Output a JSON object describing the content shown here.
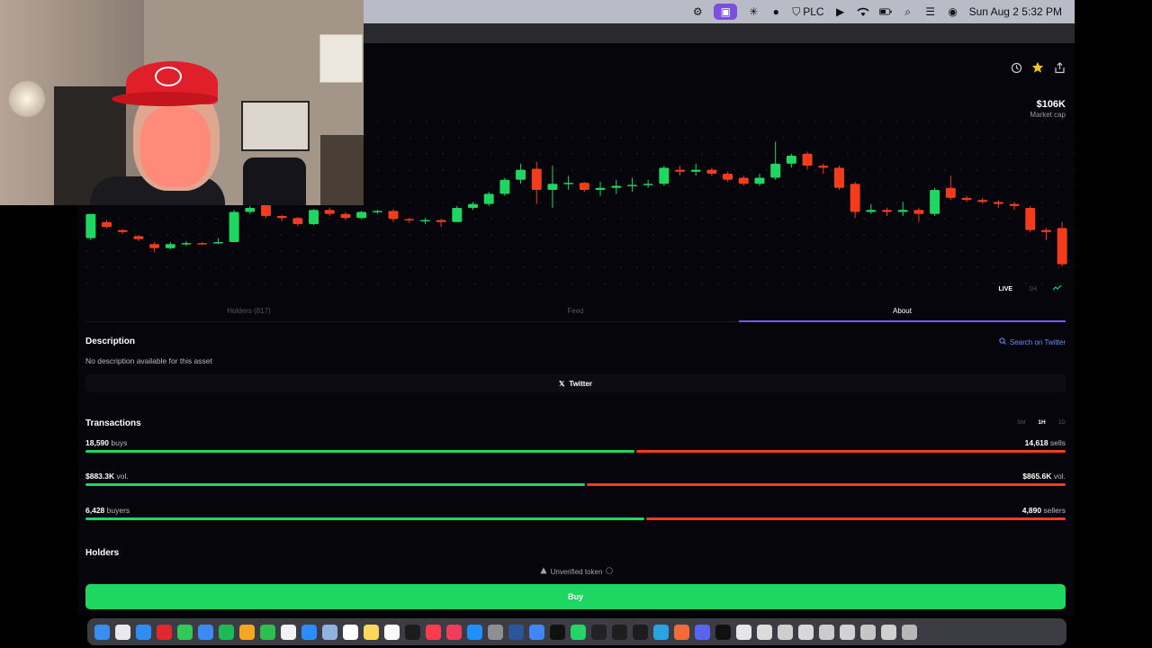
{
  "menubar": {
    "plc_label": "PLC",
    "clock": "Sun Aug 2  5:32 PM",
    "icons": [
      "settings-icon",
      "screen-record-icon",
      "sparkle-icon",
      "camera-icon",
      "shield-icon",
      "play-icon",
      "wifi-icon",
      "battery-icon",
      "search-icon",
      "control-center-icon",
      "siri-icon"
    ]
  },
  "toolbar": {
    "icons": [
      "history-icon",
      "star-icon",
      "share-icon"
    ]
  },
  "market_cap": {
    "value": "$106K",
    "label": "Market cap"
  },
  "chart_data": {
    "type": "candlestick",
    "title": "",
    "up_color": "#1ed760",
    "down_color": "#f23c1c",
    "candles": [
      {
        "dir": "up",
        "open": 46,
        "close": 70,
        "high": 70,
        "low": 44
      },
      {
        "dir": "down",
        "open": 62,
        "close": 57,
        "high": 64,
        "low": 56
      },
      {
        "dir": "down",
        "open": 54,
        "close": 52,
        "high": 55,
        "low": 50
      },
      {
        "dir": "down",
        "open": 48,
        "close": 45,
        "high": 49,
        "low": 43
      },
      {
        "dir": "down",
        "open": 40,
        "close": 36,
        "high": 42,
        "low": 32
      },
      {
        "dir": "up",
        "open": 36,
        "close": 40,
        "high": 42,
        "low": 35
      },
      {
        "dir": "up",
        "open": 40,
        "close": 41,
        "high": 43,
        "low": 38
      },
      {
        "dir": "down",
        "open": 41,
        "close": 41,
        "high": 42,
        "low": 39
      },
      {
        "dir": "up",
        "open": 41,
        "close": 42,
        "high": 46,
        "low": 40
      },
      {
        "dir": "up",
        "open": 42,
        "close": 72,
        "high": 74,
        "low": 42
      },
      {
        "dir": "up",
        "open": 72,
        "close": 76,
        "high": 78,
        "low": 70
      },
      {
        "dir": "down",
        "open": 79,
        "close": 68,
        "high": 80,
        "low": 66
      },
      {
        "dir": "down",
        "open": 68,
        "close": 66,
        "high": 69,
        "low": 63
      },
      {
        "dir": "down",
        "open": 66,
        "close": 60,
        "high": 67,
        "low": 58
      },
      {
        "dir": "up",
        "open": 60,
        "close": 74,
        "high": 75,
        "low": 59
      },
      {
        "dir": "down",
        "open": 74,
        "close": 70,
        "high": 76,
        "low": 68
      },
      {
        "dir": "down",
        "open": 70,
        "close": 66,
        "high": 72,
        "low": 64
      },
      {
        "dir": "up",
        "open": 66,
        "close": 72,
        "high": 73,
        "low": 65
      },
      {
        "dir": "up",
        "open": 72,
        "close": 73,
        "high": 74,
        "low": 70
      },
      {
        "dir": "down",
        "open": 73,
        "close": 65,
        "high": 75,
        "low": 62
      },
      {
        "dir": "down",
        "open": 65,
        "close": 64,
        "high": 66,
        "low": 61
      },
      {
        "dir": "up",
        "open": 64,
        "close": 64,
        "high": 66,
        "low": 60
      },
      {
        "dir": "down",
        "open": 64,
        "close": 62,
        "high": 65,
        "low": 57
      },
      {
        "dir": "up",
        "open": 62,
        "close": 76,
        "high": 78,
        "low": 62
      },
      {
        "dir": "up",
        "open": 76,
        "close": 80,
        "high": 82,
        "low": 74
      },
      {
        "dir": "up",
        "open": 80,
        "close": 90,
        "high": 92,
        "low": 78
      },
      {
        "dir": "up",
        "open": 90,
        "close": 104,
        "high": 106,
        "low": 88
      },
      {
        "dir": "up",
        "open": 104,
        "close": 114,
        "high": 120,
        "low": 100
      },
      {
        "dir": "down",
        "open": 115,
        "close": 94,
        "high": 122,
        "low": 80
      },
      {
        "dir": "up",
        "open": 94,
        "close": 100,
        "high": 118,
        "low": 76
      },
      {
        "dir": "up",
        "open": 100,
        "close": 101,
        "high": 108,
        "low": 94
      },
      {
        "dir": "down",
        "open": 101,
        "close": 94,
        "high": 102,
        "low": 92
      },
      {
        "dir": "up",
        "open": 94,
        "close": 96,
        "high": 102,
        "low": 88
      },
      {
        "dir": "up",
        "open": 96,
        "close": 98,
        "high": 104,
        "low": 90
      },
      {
        "dir": "up",
        "open": 98,
        "close": 99,
        "high": 106,
        "low": 92
      },
      {
        "dir": "up",
        "open": 99,
        "close": 100,
        "high": 104,
        "low": 96
      },
      {
        "dir": "up",
        "open": 100,
        "close": 116,
        "high": 118,
        "low": 98
      },
      {
        "dir": "down",
        "open": 114,
        "close": 112,
        "high": 118,
        "low": 108
      },
      {
        "dir": "up",
        "open": 112,
        "close": 114,
        "high": 120,
        "low": 108
      },
      {
        "dir": "down",
        "open": 114,
        "close": 110,
        "high": 116,
        "low": 108
      },
      {
        "dir": "down",
        "open": 110,
        "close": 104,
        "high": 112,
        "low": 102
      },
      {
        "dir": "down",
        "open": 106,
        "close": 100,
        "high": 108,
        "low": 98
      },
      {
        "dir": "up",
        "open": 100,
        "close": 106,
        "high": 110,
        "low": 98
      },
      {
        "dir": "up",
        "open": 106,
        "close": 120,
        "high": 142,
        "low": 104
      },
      {
        "dir": "up",
        "open": 120,
        "close": 128,
        "high": 130,
        "low": 116
      },
      {
        "dir": "down",
        "open": 130,
        "close": 118,
        "high": 132,
        "low": 114
      },
      {
        "dir": "down",
        "open": 118,
        "close": 116,
        "high": 120,
        "low": 110
      },
      {
        "dir": "down",
        "open": 116,
        "close": 96,
        "high": 118,
        "low": 94
      },
      {
        "dir": "down",
        "open": 100,
        "close": 72,
        "high": 102,
        "low": 66
      },
      {
        "dir": "up",
        "open": 72,
        "close": 74,
        "high": 80,
        "low": 70
      },
      {
        "dir": "down",
        "open": 74,
        "close": 72,
        "high": 76,
        "low": 68
      },
      {
        "dir": "up",
        "open": 72,
        "close": 74,
        "high": 82,
        "low": 68
      },
      {
        "dir": "down",
        "open": 74,
        "close": 70,
        "high": 76,
        "low": 62
      },
      {
        "dir": "up",
        "open": 70,
        "close": 94,
        "high": 96,
        "low": 68
      },
      {
        "dir": "down",
        "open": 96,
        "close": 86,
        "high": 108,
        "low": 84
      },
      {
        "dir": "down",
        "open": 86,
        "close": 84,
        "high": 88,
        "low": 82
      },
      {
        "dir": "down",
        "open": 84,
        "close": 82,
        "high": 86,
        "low": 80
      },
      {
        "dir": "down",
        "open": 82,
        "close": 80,
        "high": 84,
        "low": 76
      },
      {
        "dir": "down",
        "open": 80,
        "close": 78,
        "high": 82,
        "low": 74
      },
      {
        "dir": "down",
        "open": 76,
        "close": 54,
        "high": 78,
        "low": 52
      },
      {
        "dir": "down",
        "open": 54,
        "close": 52,
        "high": 56,
        "low": 44
      },
      {
        "dir": "down",
        "open": 56,
        "close": 20,
        "high": 62,
        "low": 18
      }
    ]
  },
  "range_controls": {
    "live": "LIVE",
    "one_hour": "1H"
  },
  "tabs": [
    {
      "label": "Holders (817)"
    },
    {
      "label": "Feed"
    },
    {
      "label": "About"
    }
  ],
  "about": {
    "description_title": "Description",
    "description_text": "No description available for this asset",
    "search_twitter": "Search on Twitter",
    "twitter_button": "Twitter"
  },
  "transactions": {
    "title": "Transactions",
    "periods": [
      "5M",
      "1H",
      "1D"
    ],
    "selected_period": "1H",
    "rows": [
      {
        "left_value": "18,590",
        "left_unit": " buys",
        "right_value": "14,618",
        "right_unit": " sells",
        "left_share": 0.56
      },
      {
        "left_value": "$883.3K",
        "left_unit": " vol.",
        "right_value": "$865.6K",
        "right_unit": " vol.",
        "left_share": 0.51
      },
      {
        "left_value": "6,428",
        "left_unit": " buyers",
        "right_value": "4,890",
        "right_unit": " sellers",
        "left_share": 0.57
      }
    ]
  },
  "holders": {
    "title": "Holders",
    "unverified": "Unverified token"
  },
  "buy_button": "Buy",
  "dock": {
    "apps": [
      "finder-icon",
      "launchpad-icon",
      "safari-icon",
      "opera-icon",
      "messages-icon",
      "mail-icon",
      "spotify-icon",
      "photos-icon",
      "facetime-icon",
      "calendar-icon",
      "zoom-icon",
      "preview-icon",
      "reminders-icon",
      "notes-icon",
      "freeform-icon",
      "tv-icon",
      "music-icon",
      "news-icon",
      "appstore-icon",
      "settings-icon",
      "word-icon",
      "chrome-icon",
      "tiktok-icon",
      "whatsapp-icon",
      "pen-icon",
      "stocks-icon",
      "terminal-icon",
      "telegram-icon",
      "asterisk-icon",
      "discord-icon",
      "capcut-icon",
      "document-icon",
      "folder-icon",
      "window-icon",
      "window-icon-2",
      "window-icon-3",
      "window-icon-4",
      "window-icon-5",
      "window-icon-6",
      "trash-icon"
    ]
  }
}
